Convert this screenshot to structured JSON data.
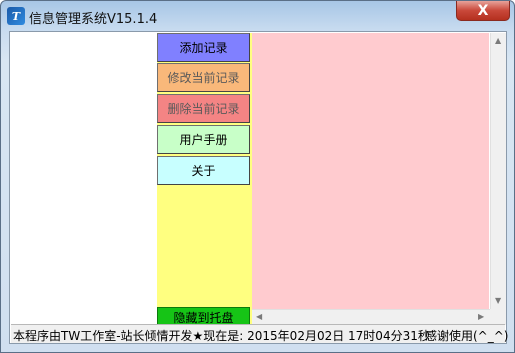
{
  "window": {
    "title": "信息管理系统V15.1.4",
    "close_glyph": "X",
    "icon_name": "app-icon"
  },
  "buttons": {
    "add": "添加记录",
    "edit": "修改当前记录",
    "delete": "删除当前记录",
    "manual": "用户手册",
    "about": "关于",
    "tray": "隐藏到托盘"
  },
  "statusbar": {
    "text": "本程序由TW工作室-站长倾情开发★现在是: 2015年02月02日 17时04分31秒",
    "thanks": "感谢使用(^_^)"
  },
  "colors": {
    "add": "#8080ff",
    "edit": "#f9b87a",
    "delete": "#f48484",
    "manual": "#c8ffc8",
    "about": "#c8ffff",
    "tray": "#16c416",
    "button_column_bg": "#ffff80",
    "content_bg": "#ffcbcf"
  }
}
